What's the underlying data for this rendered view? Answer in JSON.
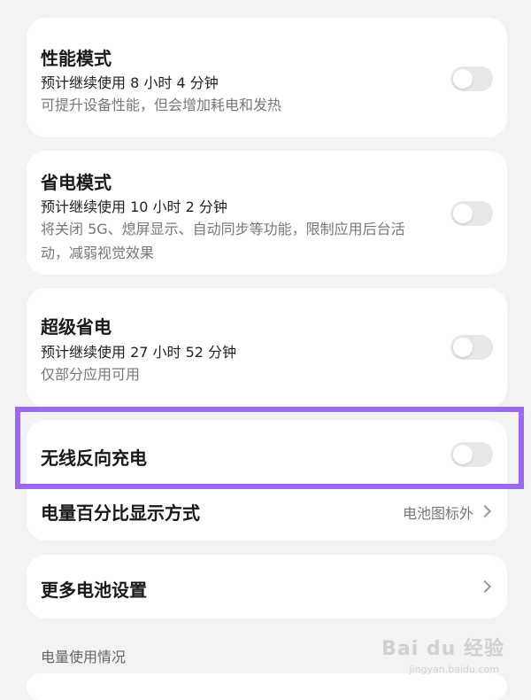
{
  "modes": [
    {
      "title": "性能模式",
      "estimate": "预计继续使用 8 小时 4 分钟",
      "description": "可提升设备性能，但会增加耗电和发热",
      "enabled": false
    },
    {
      "title": "省电模式",
      "estimate": "预计继续使用 10 小时 2 分钟",
      "description": "将关闭 5G、熄屏显示、自动同步等功能，限制应用后台活动，减弱视觉效果",
      "enabled": false
    },
    {
      "title": "超级省电",
      "estimate": "预计继续使用 27 小时 52 分钟",
      "description": "仅部分应用可用",
      "enabled": false
    }
  ],
  "wireless_reverse": {
    "title": "无线反向充电",
    "enabled": false
  },
  "battery_percentage": {
    "title": "电量百分比显示方式",
    "value": "电池图标外"
  },
  "more_settings": {
    "title": "更多电池设置"
  },
  "usage_section": {
    "label": "电量使用情况"
  },
  "watermark": {
    "text": "Bai du 经验",
    "sub": "jingyan.baidu.com"
  },
  "colors": {
    "background": "#f1f3f5",
    "card": "#ffffff",
    "toggle_off": "#e6e7e9",
    "highlight": "#9b6af0"
  }
}
